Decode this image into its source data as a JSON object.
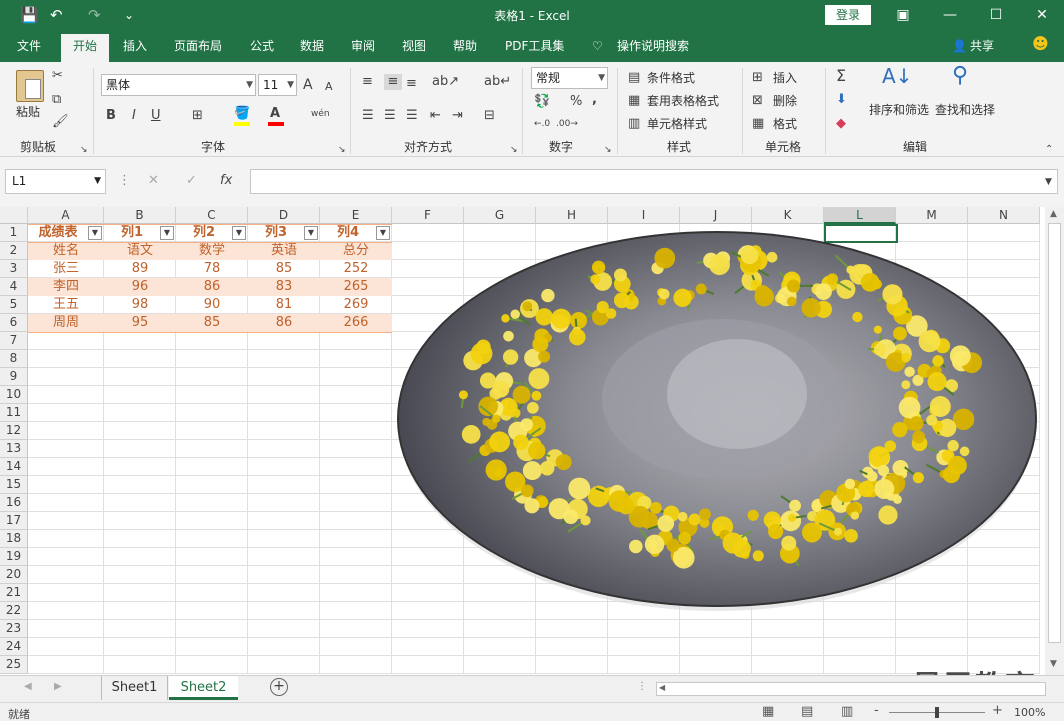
{
  "window": {
    "title": "表格1  -  Excel",
    "login_label": "登录",
    "qa_save": "💾",
    "qa_undo": "↶",
    "qa_redo": "↷",
    "qa_more": "⌄"
  },
  "menu": {
    "items": [
      "文件",
      "开始",
      "插入",
      "页面布局",
      "公式",
      "数据",
      "审阅",
      "视图",
      "帮助",
      "PDF工具集",
      "操作说明搜索"
    ],
    "active": "开始",
    "share": "共享"
  },
  "ribbon": {
    "clipboard": {
      "paste": "粘贴",
      "label": "剪贴板"
    },
    "font": {
      "name": "黑体",
      "size": "11",
      "label": "字体",
      "bold": "B",
      "italic": "I",
      "underline": "U",
      "grow": "A",
      "shrink": "A",
      "font_color": "A",
      "phonetic": "wén"
    },
    "alignment": {
      "label": "对齐方式"
    },
    "number": {
      "format": "常规",
      "label": "数字",
      "percent": "%",
      "comma": ","
    },
    "styles": {
      "conditional": "条件格式",
      "table": "套用表格格式",
      "cell_styles": "单元格样式",
      "label": "样式"
    },
    "cells": {
      "insert": "插入",
      "delete": "删除",
      "format": "格式",
      "label": "单元格"
    },
    "editing": {
      "sort": "排序和筛选",
      "find": "查找和选择",
      "sigma": "Σ",
      "label": "编辑"
    }
  },
  "formula_bar": {
    "name_box": "L1",
    "fx": "fx",
    "value": ""
  },
  "sheet": {
    "columns": [
      "A",
      "B",
      "C",
      "D",
      "E",
      "F",
      "G",
      "H",
      "I",
      "J",
      "K",
      "L",
      "M",
      "N"
    ],
    "rows": [
      "1",
      "2",
      "3",
      "4",
      "5",
      "6",
      "7",
      "8",
      "9",
      "10",
      "11",
      "12",
      "13",
      "14",
      "15",
      "16",
      "17",
      "18",
      "19",
      "20",
      "21",
      "22",
      "23",
      "24",
      "25"
    ],
    "table": {
      "header": [
        "成绩表",
        "列1",
        "列2",
        "列3",
        "列4"
      ],
      "rows": [
        [
          "姓名",
          "语文",
          "数学",
          "英语",
          "总分"
        ],
        [
          "张三",
          "89",
          "78",
          "85",
          "252"
        ],
        [
          "李四",
          "96",
          "86",
          "83",
          "265"
        ],
        [
          "王五",
          "98",
          "90",
          "81",
          "269"
        ],
        [
          "周周",
          "95",
          "85",
          "86",
          "266"
        ]
      ]
    },
    "selected_cell": "L1",
    "table_colors": {
      "band": "#fce4d6",
      "text": "#c0622b",
      "border": "#f4b084"
    }
  },
  "sheets": {
    "tabs": [
      "Sheet1",
      "Sheet2"
    ],
    "active": "Sheet2",
    "add": "+"
  },
  "status": {
    "ready": "就绪",
    "zoom": "100%",
    "zoom_minus": "-",
    "zoom_plus": "+"
  },
  "watermark": "最需教育"
}
